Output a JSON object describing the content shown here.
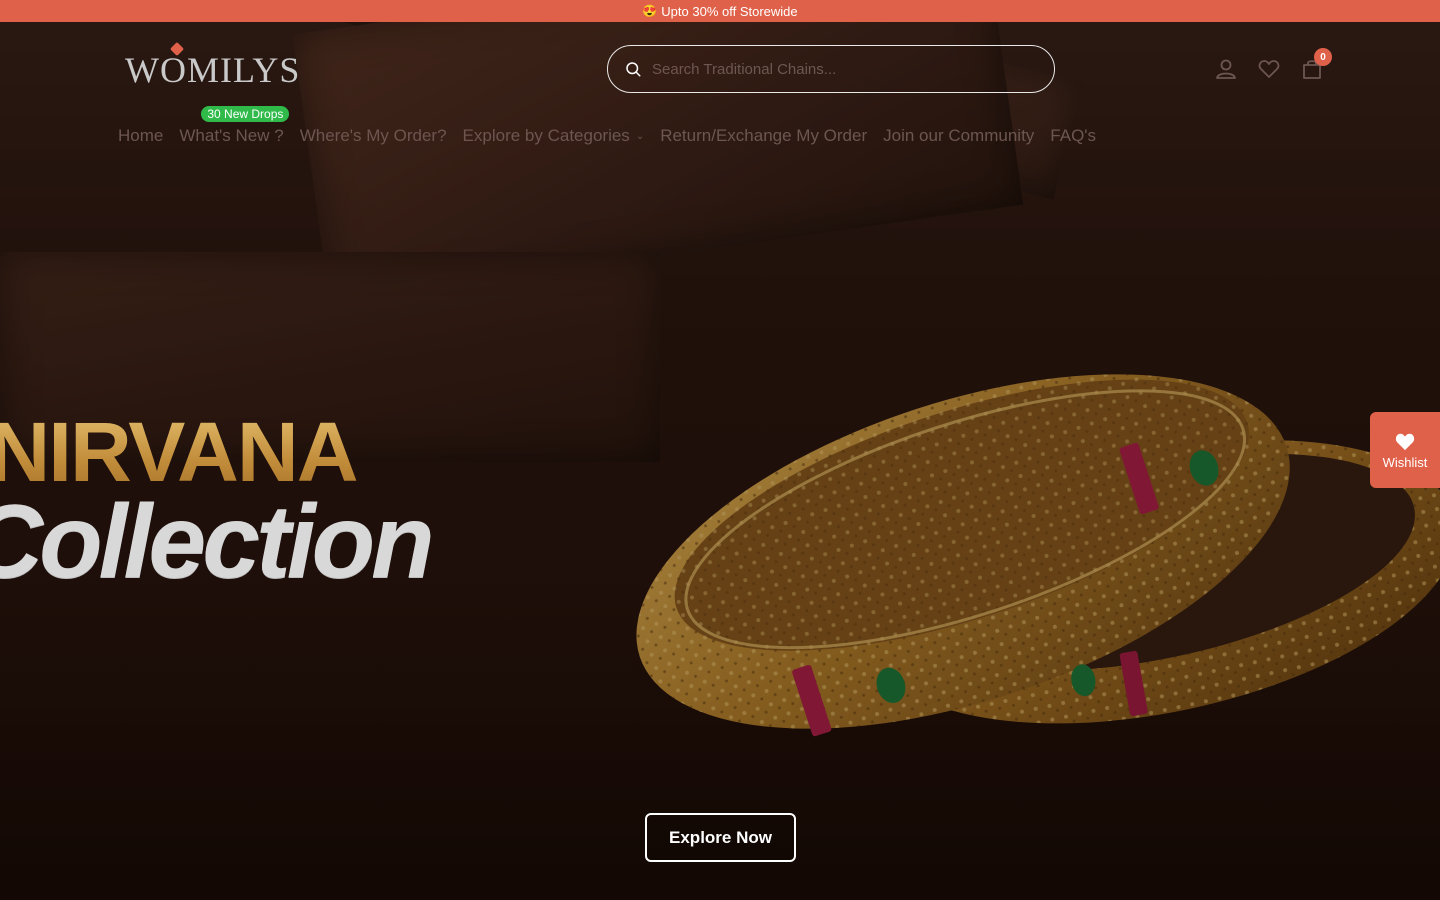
{
  "announcement": {
    "emoji": "😍",
    "text": "Upto 30% off Storewide"
  },
  "header": {
    "logo_text": "WOMILYS",
    "search_placeholder": "Search Traditional Chains...",
    "icons": [
      "account-icon",
      "heart-icon",
      "bag-icon"
    ],
    "cart_count": "0"
  },
  "nav": {
    "items": [
      {
        "label": "Home"
      },
      {
        "label": "What's New ?",
        "badge": "30 New Drops"
      },
      {
        "label": "Where's My Order?"
      },
      {
        "label": "Explore by Categories",
        "dropdown": true
      },
      {
        "label": "Return/Exchange My Order"
      },
      {
        "label": "Join our Community"
      },
      {
        "label": "FAQ's"
      }
    ]
  },
  "hero": {
    "title_line1": "NIRVANA",
    "title_line2": "Collection",
    "cta_label": "Explore Now"
  },
  "wishlist": {
    "label": "Wishlist"
  },
  "colors": {
    "accent": "#e0614a",
    "badge_green": "#2fba4a",
    "gold": "#c9953e"
  }
}
